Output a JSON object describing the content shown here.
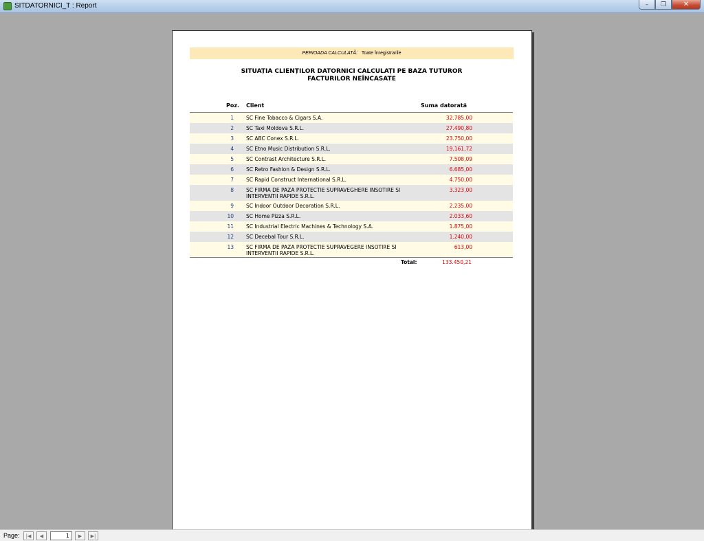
{
  "window": {
    "title": "SITDATORNICI_T : Report",
    "minimize_glyph": "–",
    "restore_glyph": "❐",
    "close_glyph": "✕"
  },
  "report": {
    "period_label": "PERIOADA CALCULATĂ:",
    "period_value": "Toate înregistrarile",
    "title_line1": "SITUAȚIA CLIENȚILOR DATORNICI CALCULAȚI PE BAZA TUTUROR",
    "title_line2": "FACTURILOR NEÎNCASATE",
    "columns": {
      "poz": "Poz.",
      "client": "Client",
      "amount": "Suma datorată"
    },
    "rows": [
      {
        "poz": "1",
        "client": "SC Fine Tobacco & Cigars S.A.",
        "amount": "32.785,00"
      },
      {
        "poz": "2",
        "client": "SC Taxi Moldova S.R.L.",
        "amount": "27.490,80"
      },
      {
        "poz": "3",
        "client": "SC ABC Conex S.R.L.",
        "amount": "23.750,00"
      },
      {
        "poz": "4",
        "client": "SC Etno Music Distribution S.R.L.",
        "amount": "19.161,72"
      },
      {
        "poz": "5",
        "client": "SC Contrast Architecture S.R.L.",
        "amount": "7.508,09"
      },
      {
        "poz": "6",
        "client": "SC Retro Fashion & Design S.R.L.",
        "amount": "6.685,00"
      },
      {
        "poz": "7",
        "client": "SC Rapid Construct International S.R.L.",
        "amount": "4.750,00"
      },
      {
        "poz": "8",
        "client": "SC FIRMA DE PAZA PROTECTIE SUPRAVEGHERE INSOTIRE SI INTERVENTII RAPIDE S.R.L.",
        "amount": "3.323,00"
      },
      {
        "poz": "9",
        "client": "SC Indoor Outdoor Decoration S.R.L.",
        "amount": "2.235,00"
      },
      {
        "poz": "10",
        "client": "SC Home Pizza S.R.L.",
        "amount": "2.033,60"
      },
      {
        "poz": "11",
        "client": "SC Industrial Electric Machines & Technology S.A.",
        "amount": "1.875,00"
      },
      {
        "poz": "12",
        "client": "SC Decebal Tour S.R.L.",
        "amount": "1.240,00"
      },
      {
        "poz": "13",
        "client": "SC FIRMA DE PAZA PROTECTIE SUPRAVEGERE INSOTIRE SI INTERVENTII RAPIDE S.R.L.",
        "amount": "613,00"
      }
    ],
    "total_label": "Total:",
    "total_value": "133.450,21"
  },
  "navigation": {
    "page_label": "Page:",
    "current_page": "1",
    "first_glyph": "|◀",
    "prev_glyph": "◀",
    "next_glyph": "▶",
    "last_glyph": "▶|"
  }
}
